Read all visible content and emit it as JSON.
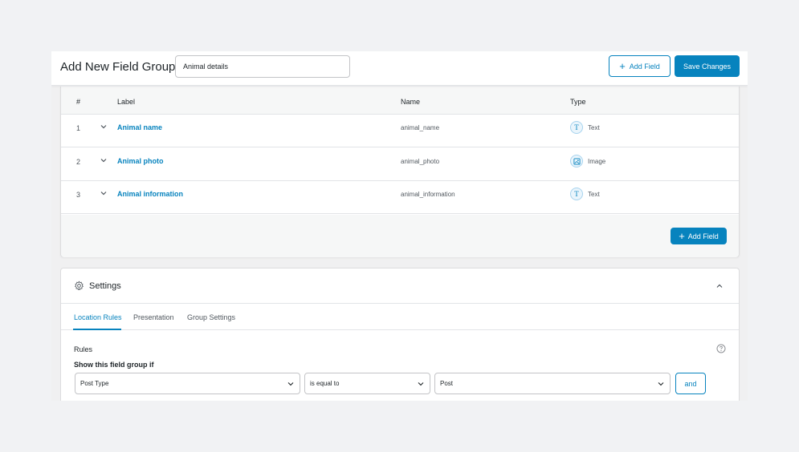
{
  "header": {
    "title": "Add New Field Group",
    "title_input_value": "Animal details",
    "add_field_label": "Add Field",
    "save_label": "Save Changes"
  },
  "fields_table": {
    "columns": [
      "#",
      "Label",
      "Name",
      "Type"
    ],
    "rows": [
      {
        "num": "1",
        "label": "Animal name",
        "name": "animal_name",
        "type": "Text",
        "type_icon": "text-icon"
      },
      {
        "num": "2",
        "label": "Animal photo",
        "name": "animal_photo",
        "type": "Image",
        "type_icon": "image-icon"
      },
      {
        "num": "3",
        "label": "Animal information",
        "name": "animal_information",
        "type": "Text",
        "type_icon": "text-icon"
      }
    ],
    "add_field_label": "Add Field"
  },
  "settings": {
    "title": "Settings",
    "tabs": [
      {
        "label": "Location Rules",
        "active": true
      },
      {
        "label": "Presentation",
        "active": false
      },
      {
        "label": "Group Settings",
        "active": false
      }
    ],
    "rules_label": "Rules",
    "show_if_label": "Show this field group if",
    "rule": {
      "param": "Post Type",
      "operator": "is equal to",
      "value": "Post",
      "and_label": "and"
    }
  },
  "colors": {
    "accent": "#0783be",
    "page_bg": "#f1f2f4",
    "panel_bg": "#f6f7f7"
  }
}
